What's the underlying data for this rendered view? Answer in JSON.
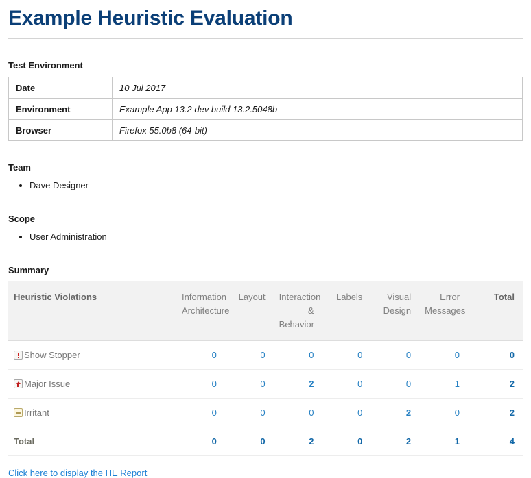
{
  "title": "Example Heuristic Evaluation",
  "sections": {
    "test_environment": {
      "heading": "Test Environment",
      "rows": [
        {
          "key": "Date",
          "value": "10 Jul 2017"
        },
        {
          "key": "Environment",
          "value": "Example App 13.2 dev build 13.2.5048b"
        },
        {
          "key": "Browser",
          "value": "Firefox 55.0b8 (64-bit)"
        }
      ]
    },
    "team": {
      "heading": "Team",
      "members": [
        "Dave Designer"
      ]
    },
    "scope": {
      "heading": "Scope",
      "items": [
        "User Administration"
      ]
    },
    "summary": {
      "heading": "Summary",
      "columns": [
        "Heuristic Violations",
        "Information Architecture",
        "Layout",
        "Interaction & Behavior",
        "Labels",
        "Visual Design",
        "Error Messages",
        "Total"
      ],
      "rows": [
        {
          "icon": "show-stopper-icon",
          "severity": "Show Stopper",
          "information_architecture": "0",
          "layout": "0",
          "interaction_behavior": "0",
          "labels": "0",
          "visual_design": "0",
          "error_messages": "0",
          "total": "0"
        },
        {
          "icon": "major-issue-icon",
          "severity": "Major Issue",
          "information_architecture": "0",
          "layout": "0",
          "interaction_behavior": "2",
          "labels": "0",
          "visual_design": "0",
          "error_messages": "1",
          "total": "2"
        },
        {
          "icon": "irritant-icon",
          "severity": "Irritant",
          "information_architecture": "0",
          "layout": "0",
          "interaction_behavior": "0",
          "labels": "0",
          "visual_design": "2",
          "error_messages": "0",
          "total": "2"
        }
      ],
      "total_row": {
        "severity": "Total",
        "information_architecture": "0",
        "layout": "0",
        "interaction_behavior": "2",
        "labels": "0",
        "visual_design": "2",
        "error_messages": "1",
        "total": "4"
      }
    }
  },
  "footer": {
    "report_link": "Click here to display the HE Report"
  },
  "colors": {
    "title": "#0b3f77",
    "link": "#1a7fd4",
    "value": "#2580c3",
    "value_bold": "#1368a8",
    "header_bg": "#f2f2f2",
    "header_text": "#808080",
    "severity_critical": "#d02020",
    "severity_irritant": "#b09a55"
  }
}
